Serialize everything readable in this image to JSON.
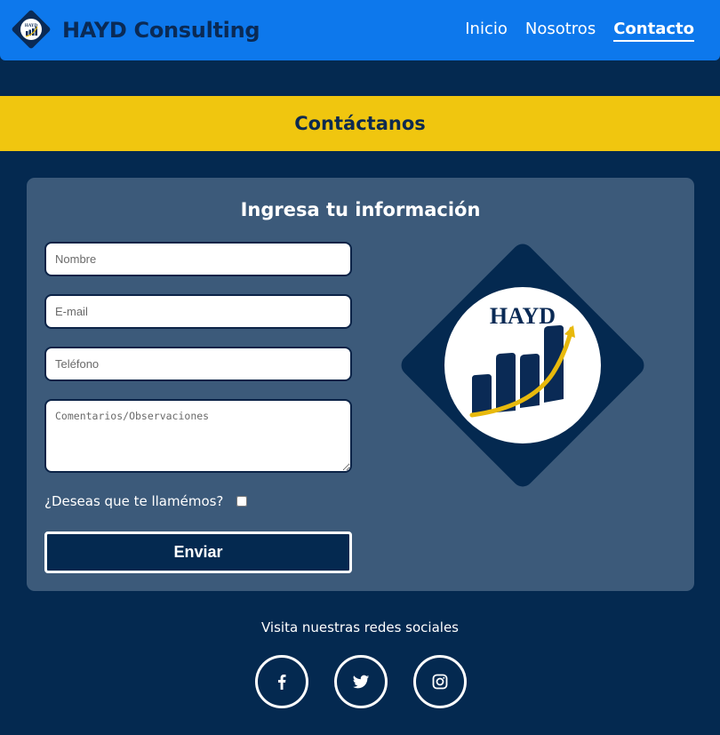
{
  "brand": {
    "name": "HAYD Consulting",
    "logo_text": "HAYD"
  },
  "nav": {
    "items": [
      {
        "label": "Inicio",
        "active": false
      },
      {
        "label": "Nosotros",
        "active": false
      },
      {
        "label": "Contacto",
        "active": true
      }
    ]
  },
  "banner": {
    "title": "Contáctanos"
  },
  "form": {
    "title": "Ingresa tu información",
    "name_placeholder": "Nombre",
    "email_placeholder": "E-mail",
    "phone_placeholder": "Teléfono",
    "comments_placeholder": "Comentarios/Observaciones",
    "call_label": "¿Deseas que te llamémos?",
    "submit_label": "Enviar"
  },
  "footer": {
    "text": "Visita nuestras redes sociales",
    "socials": [
      "facebook-icon",
      "twitter-icon",
      "instagram-icon"
    ]
  },
  "colors": {
    "navbar": "#0d78ec",
    "background": "#042950",
    "banner": "#f0c60f",
    "card": "#3c5a7a",
    "accent_gold": "#e8b90c"
  }
}
